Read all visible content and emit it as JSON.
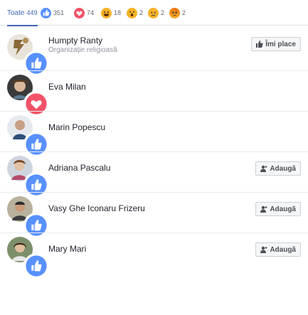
{
  "tabs": [
    {
      "label": "Toate",
      "count": "449",
      "icon": "all"
    },
    {
      "label": "",
      "count": "351",
      "icon": "like-icon"
    },
    {
      "label": "",
      "count": "74",
      "icon": "love-icon"
    },
    {
      "label": "",
      "count": "18",
      "icon": "haha-icon"
    },
    {
      "label": "",
      "count": "2",
      "icon": "wow-icon"
    },
    {
      "label": "",
      "count": "2",
      "icon": "sad-icon"
    },
    {
      "label": "",
      "count": "2",
      "icon": "angry-icon"
    }
  ],
  "people": [
    {
      "name": "Humpty Ranty",
      "subtitle": "Organizație religioasă",
      "action": "Îmi place",
      "action_type": "like"
    },
    {
      "name": "Eva Milan",
      "subtitle": "",
      "action": "",
      "action_type": "none"
    },
    {
      "name": "Marin Popescu",
      "subtitle": "",
      "action": "",
      "action_type": "none"
    },
    {
      "name": "Adriana Pascalu",
      "subtitle": "",
      "action": "Adaugă",
      "action_type": "add"
    },
    {
      "name": "Vasy Ghe Iconaru Frizeru",
      "subtitle": "",
      "action": "Adaugă",
      "action_type": "add"
    },
    {
      "name": "Mary Mari",
      "subtitle": "",
      "action": "Adaugă",
      "action_type": "add"
    }
  ],
  "colors": {
    "accent": "#4267b2",
    "like": "#5890ff",
    "love": "#f25268",
    "haha": "#f7b125"
  }
}
